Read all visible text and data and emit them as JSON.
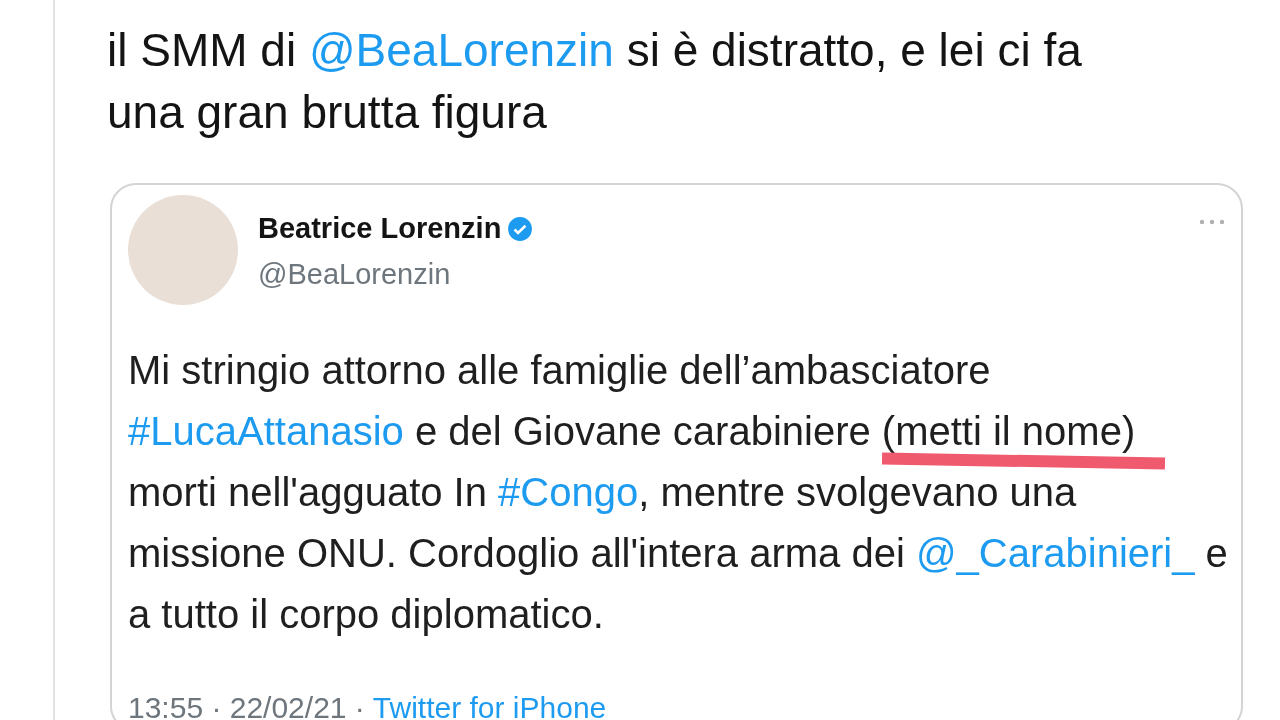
{
  "post_text": [
    {
      "kind": "text",
      "text": "il SMM di "
    },
    {
      "kind": "link",
      "text": "@BeaLorenzin"
    },
    {
      "kind": "text",
      "text": " si è distratto, e lei ci fa una gran brutta figura"
    }
  ],
  "quoted_tweet": {
    "name": "Beatrice Lorenzin",
    "verified": true,
    "handle": "@BeaLorenzin",
    "body": [
      {
        "kind": "text",
        "text": "Mi stringio attorno alle famiglie dell’ambasciatore "
      },
      {
        "kind": "link",
        "text": "#LucaAttanasio"
      },
      {
        "kind": "text",
        "text": " e del Giovane carabiniere "
      },
      {
        "kind": "marked",
        "text": "(metti il nome)",
        "color": "#f05a6e"
      },
      {
        "kind": "text",
        "text": " morti nell'agguato In "
      },
      {
        "kind": "link",
        "text": "#Congo"
      },
      {
        "kind": "text",
        "text": ", mentre svolgevano una missione ONU. Cordoglio all'intera arma dei "
      },
      {
        "kind": "link",
        "text": "@_Carabinieri_"
      },
      {
        "kind": "text",
        "text": " e a tutto il corpo diplomatico."
      }
    ],
    "time": "13:55 · 22/02/21 ·",
    "source": "Twitter for iPhone"
  }
}
